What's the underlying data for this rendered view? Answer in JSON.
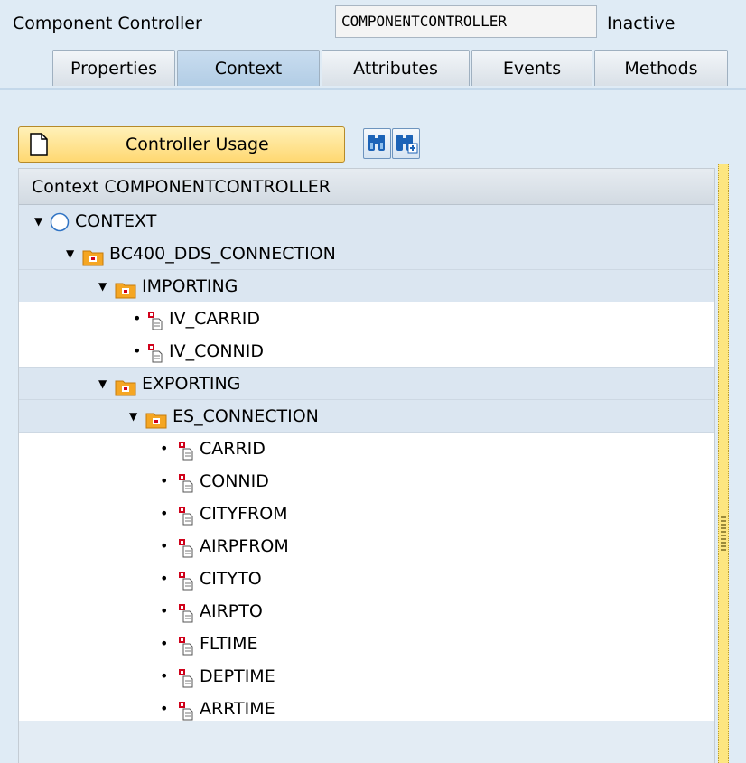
{
  "header": {
    "label": "Component Controller",
    "controller_name": "COMPONENTCONTROLLER",
    "status": "Inactive"
  },
  "tabs": [
    {
      "label": "Properties",
      "active": false
    },
    {
      "label": "Context",
      "active": true
    },
    {
      "label": "Attributes",
      "active": false
    },
    {
      "label": "Events",
      "active": false
    },
    {
      "label": "Methods",
      "active": false
    }
  ],
  "toolbar": {
    "controller_usage_label": "Controller Usage",
    "icons": [
      "binoculars-icon",
      "binoculars-plus-icon"
    ]
  },
  "tree": {
    "column_header": "Context COMPONENTCONTROLLER",
    "rows": [
      {
        "label": "CONTEXT",
        "type": "root"
      },
      {
        "label": "BC400_DDS_CONNECTION",
        "type": "node"
      },
      {
        "label": "IMPORTING",
        "type": "node"
      },
      {
        "label": "IV_CARRID",
        "type": "attribute"
      },
      {
        "label": "IV_CONNID",
        "type": "attribute"
      },
      {
        "label": "EXPORTING",
        "type": "node"
      },
      {
        "label": "ES_CONNECTION",
        "type": "node"
      },
      {
        "label": "CARRID",
        "type": "attribute"
      },
      {
        "label": "CONNID",
        "type": "attribute"
      },
      {
        "label": "CITYFROM",
        "type": "attribute"
      },
      {
        "label": "AIRPFROM",
        "type": "attribute"
      },
      {
        "label": "CITYTO",
        "type": "attribute"
      },
      {
        "label": "AIRPTO",
        "type": "attribute"
      },
      {
        "label": "FLTIME",
        "type": "attribute"
      },
      {
        "label": "DEPTIME",
        "type": "attribute"
      },
      {
        "label": "ARRTIME",
        "type": "attribute"
      }
    ]
  },
  "colors": {
    "background": "#dfebf5",
    "node_row": "#dbe6f1",
    "button_yellow": "#ffd872",
    "folder_orange": "#f5a623",
    "attribute_red": "#d0021b"
  }
}
